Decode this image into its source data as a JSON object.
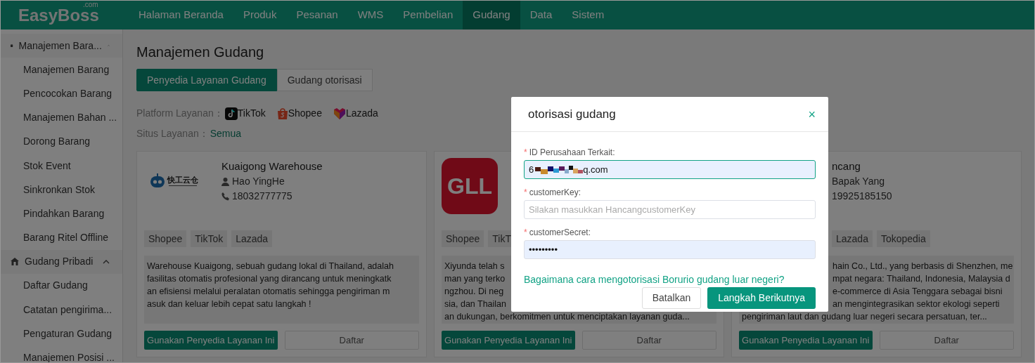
{
  "brand": {
    "name": "EasyBoss",
    "suffix": ".com"
  },
  "nav": [
    {
      "label": "Halaman Beranda",
      "selected": false
    },
    {
      "label": "Produk",
      "selected": false
    },
    {
      "label": "Pesanan",
      "selected": false
    },
    {
      "label": "WMS",
      "selected": false
    },
    {
      "label": "Pembelian",
      "selected": false
    },
    {
      "label": "Gudang",
      "selected": true
    },
    {
      "label": "Data",
      "selected": false
    },
    {
      "label": "Sistem",
      "selected": false
    }
  ],
  "sidebar": [
    {
      "label": "Manajemen Bara...",
      "expanded": true,
      "children": [
        "Manajemen Barang",
        "Pencocokan Barang",
        "Manajemen Bahan ...",
        "Dorong Barang",
        "Stok Event",
        "Sinkronkan Stok",
        "Pindahkan Barang",
        "Barang Ritel Offline"
      ]
    },
    {
      "label": "Gudang Pribadi",
      "expanded": true,
      "children": [
        "Daftar Gudang",
        "Catatan pengirima...",
        "Pengaturan Gudang",
        "Manajemen Posisi ..."
      ]
    }
  ],
  "page_title": "Manajemen Gudang",
  "tabs": [
    {
      "label": "Penyedia Layanan Gudang",
      "selected": true
    },
    {
      "label": "Gudang otorisasi",
      "selected": false
    }
  ],
  "filters": [
    {
      "label": "Platform Layanan：",
      "options": [
        {
          "label": "TikTok",
          "kind": "tiktok"
        },
        {
          "label": "Shopee",
          "kind": "shopee"
        },
        {
          "label": "Lazada",
          "kind": "lazada"
        }
      ]
    },
    {
      "label": "Situs Layanan：",
      "options": [
        {
          "label": "Semua",
          "kind": "text"
        }
      ]
    }
  ],
  "cards": [
    {
      "kind": "full",
      "logo": {
        "kind": "kuaigong",
        "text": "快工云仓"
      },
      "title": "Kuaigong Warehouse",
      "contact": "Hao YingHe",
      "phone": "18032777775",
      "tags": [
        "Shopee",
        "TikTok",
        "Lazada"
      ],
      "description": [
        {
          "text": "Warehouse Kuaigong, sebuah gudang lokal di Thailand, adalah",
          "kind": "full"
        },
        {
          "text": "fasilitas otomatis profesional yang dirancang untuk meningkatk",
          "kind": "full"
        },
        {
          "text": "an efisiensi melalui peralatan otomatis sehingga  pengiriman m",
          "kind": "full"
        },
        {
          "text": "asuk dan keluar lebih cepat satu langkah !",
          "kind": "full"
        }
      ],
      "use_button": "Gunakan Penyedia Layanan Ini",
      "list_button": "Daftar"
    },
    {
      "kind": "left_of_dialog",
      "logo": {
        "kind": "gll",
        "text": "GLL"
      },
      "tags": [
        "Shopee",
        "TikT"
      ],
      "description": [
        {
          "text": "Xiyunda telah s",
          "kind": "full"
        },
        {
          "text": "man yang terko",
          "kind": "full"
        },
        {
          "text": "ngzhou. Di neg",
          "kind": "full"
        },
        {
          "text": "sia, dan Thailan",
          "kind": "full"
        },
        {
          "text": "an dukungan, berkomitmen untuk menciptakan layanan guda...",
          "kind": "full"
        }
      ],
      "use_button": "Gunakan Penyedia Layanan Ini",
      "list_button": "Daftar"
    },
    {
      "kind": "right_of_dialog",
      "title": "ncang",
      "contact": "Bapak Yang",
      "phone": "19925185150",
      "tags": [
        "Lazada",
        "Tokopedia"
      ],
      "description": [
        {
          "text": "hain Co., Ltd., yang berbasis di Shenzhen, me",
          "kind": "beside_dialog"
        },
        {
          "text": "mpat negara: Thailand, Indonesia, Malaysia d",
          "kind": "beside_dialog"
        },
        {
          "text": "e-commerce di Asia Tenggara sebagai bisni",
          "kind": "beside_dialog"
        },
        {
          "text": "an mengintegrasikan sektor ekologi seperti",
          "kind": "beside_dialog"
        },
        {
          "text": "pengiriman laut dan gudang luar negeri secara persatuan, ter...",
          "kind": "full"
        }
      ],
      "use_button": "Gunakan Penyedia Layanan Ini",
      "list_button": "Daftar"
    }
  ],
  "dialog": {
    "title": "otorisasi gudang",
    "close": "×",
    "fields": [
      {
        "label": "ID Perusahaan Terkait:",
        "marker": "*",
        "value_start": "6",
        "redacted": true,
        "value_end": "q.com",
        "focused": true,
        "autofilled": true
      },
      {
        "label": "customerKey:",
        "marker": "*",
        "placeholder": "Silakan masukkan HancangcustomerKey",
        "focused": false,
        "autofilled": false
      },
      {
        "label": "customerSecret:",
        "marker": "*",
        "value_start": "•••••••••",
        "focused": false,
        "autofilled": true
      }
    ],
    "help_link": "Bagaimana cara mengotorisasi Borurio gudang luar negeri?",
    "cancel": "Batalkan",
    "next": "Langkah Berikutnya"
  }
}
